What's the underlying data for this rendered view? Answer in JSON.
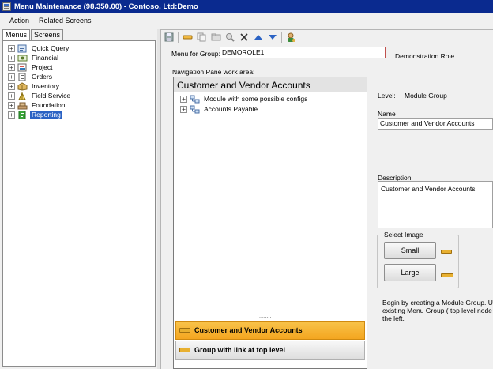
{
  "window": {
    "title": "Menu Maintenance (98.350.00) - Contoso, Ltd:Demo"
  },
  "menubar": {
    "items": [
      "Action",
      "Related Screens"
    ]
  },
  "left_panel": {
    "tabs": [
      "Menus",
      "Screens"
    ],
    "active_tab": "Menus",
    "tree": [
      {
        "label": "Quick Query",
        "icon": "query-icon"
      },
      {
        "label": "Financial",
        "icon": "financial-icon"
      },
      {
        "label": "Project",
        "icon": "project-icon"
      },
      {
        "label": "Orders",
        "icon": "orders-icon"
      },
      {
        "label": "Inventory",
        "icon": "inventory-icon"
      },
      {
        "label": "Field Service",
        "icon": "field-service-icon"
      },
      {
        "label": "Foundation",
        "icon": "foundation-icon"
      },
      {
        "label": "Reporting",
        "icon": "reporting-icon",
        "selected": true
      }
    ]
  },
  "toolbar": {
    "buttons": [
      "save-icon",
      "new-icon",
      "copy-icon",
      "folder-icon",
      "find-icon",
      "delete-icon",
      "move-up-icon",
      "move-down-icon",
      "user-icon"
    ]
  },
  "form": {
    "menu_for_group_label": "Menu for Group:",
    "menu_for_group_value": "DEMOROLE1",
    "group_description": "Demonstration Role",
    "nav_pane_label": "Navigation Pane work area:",
    "level_label": "Level:",
    "level_value": "Module Group",
    "name_label": "Name",
    "name_value": "Customer and Vendor Accounts",
    "description_label": "Description",
    "description_value": "Customer and Vendor Accounts"
  },
  "nav_pane": {
    "header": "Customer and Vendor Accounts",
    "tree": [
      {
        "label": "Module with some possible configs"
      },
      {
        "label": "Accounts Payable"
      }
    ],
    "grip": "........",
    "buttons": [
      {
        "label": "Customer and Vendor Accounts",
        "active": true
      },
      {
        "label": "Group with link at top level",
        "active": false
      }
    ]
  },
  "select_image": {
    "legend": "Select Image",
    "small_label": "Small",
    "large_label": "Large"
  },
  "help_text": "Begin by creating a Module Group. Use\nexisting Menu Group ( top level node )\nthe left.",
  "colors": {
    "titlebar": "#0a2a8f",
    "selection": "#2a62c4",
    "active_nav_button": "#f4a620"
  }
}
